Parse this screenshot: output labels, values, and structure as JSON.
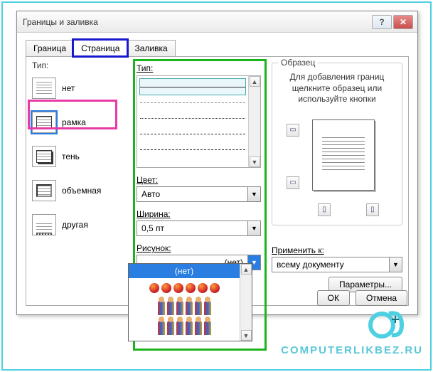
{
  "dialog": {
    "title": "Границы и заливка"
  },
  "tabs": {
    "border": "Граница",
    "page": "Страница",
    "shading": "Заливка"
  },
  "type": {
    "heading": "Тип:",
    "none": "нет",
    "box": "рамка",
    "shadow": "тень",
    "threeD": "объемная",
    "custom": "другая"
  },
  "style": {
    "heading": "Тип:",
    "color_label": "Цвет:",
    "color_value": "Авто",
    "width_label": "Ширина:",
    "width_value": "0,5 пт",
    "art_label": "Рисунок:",
    "art_value": "(нет)",
    "art_none": "(нет)"
  },
  "preview": {
    "heading": "Образец",
    "hint1": "Для добавления границ",
    "hint2": "щелкните образец или",
    "hint3": "используйте кнопки",
    "apply_label": "Применить к:",
    "apply_value": "всему документу",
    "params": "Параметры..."
  },
  "buttons": {
    "ok": "ОК",
    "cancel": "Отмена"
  },
  "watermark": "COMPUTERLIKBEZ.RU"
}
